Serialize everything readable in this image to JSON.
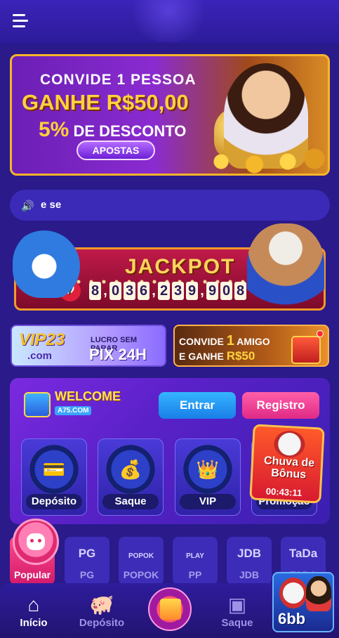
{
  "banner": {
    "line1": "CONVIDE 1 PESSOA",
    "line2": "GANHE R$50,00",
    "line3_pct": "5%",
    "line3_rest": " DE DESCONTO",
    "button": "APOSTAS"
  },
  "marquee": {
    "text": "e se"
  },
  "jackpot": {
    "title": "JACKPOT",
    "ball": "7",
    "digits": [
      "8",
      "0",
      "3",
      "6",
      "2",
      "3",
      "9",
      "9",
      "0",
      "8"
    ]
  },
  "promos": {
    "vip_title": "VIP23",
    "vip_domain": ".com",
    "vip_sub": "LUCRO SEM PARAR",
    "vip_pix": "PIX 24H",
    "amigo_l1": "CONVIDE ",
    "amigo_num": "1",
    "amigo_l1b": " AMIGO",
    "amigo_l2": "E GANHE ",
    "amigo_amount": "R$50"
  },
  "welcome": {
    "title": "WELCOME",
    "site": "A75.COM"
  },
  "auth": {
    "login": "Entrar",
    "register": "Registro"
  },
  "quick_actions": [
    {
      "label": "Depósito",
      "icon": "wallet-coin-icon"
    },
    {
      "label": "Saque",
      "icon": "card-coin-icon"
    },
    {
      "label": "VIP",
      "icon": "vip-wings-icon"
    },
    {
      "label": "Promoção",
      "icon": "promo-icon"
    }
  ],
  "chuva": {
    "title": "Chuva de Bônus",
    "timer": "00:43:11"
  },
  "categories": [
    {
      "label": "Popular",
      "logo": ""
    },
    {
      "label": "PG",
      "logo": "PG"
    },
    {
      "label": "POPOK",
      "logo": "POPOK"
    },
    {
      "label": "PP",
      "logo": "PLAY"
    },
    {
      "label": "JDB",
      "logo": "JDB"
    },
    {
      "label": "TADA",
      "logo": "TaDa"
    }
  ],
  "bottom_nav": [
    {
      "label": "Início",
      "icon": "home-icon"
    },
    {
      "label": "Depósito",
      "icon": "piggy-bank-icon"
    },
    {
      "label": "",
      "icon": "gift-icon"
    },
    {
      "label": "Saque",
      "icon": "wallet-icon"
    }
  ],
  "ad": {
    "brand": "6bb"
  },
  "colors": {
    "bg": "#2a1a8a",
    "accent_blue": "#1a7ee8",
    "accent_pink": "#e02a86",
    "gold": "#ffd23f"
  }
}
